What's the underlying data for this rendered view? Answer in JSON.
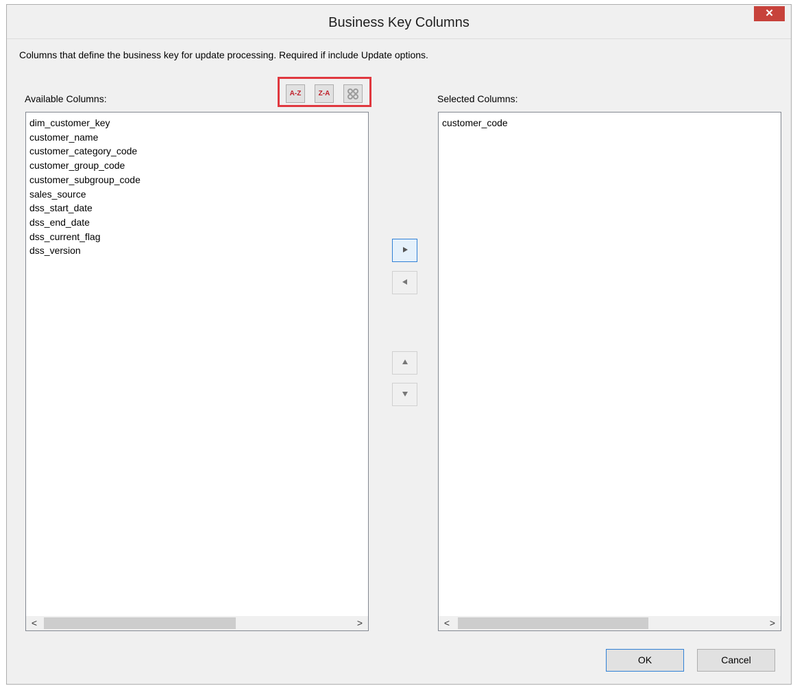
{
  "window": {
    "title": "Business Key Columns",
    "close_symbol": "✕"
  },
  "description": "Columns that define the business key for update processing. Required if include Update options.",
  "available": {
    "label": "Available Columns:",
    "items": [
      "dim_customer_key",
      "customer_name",
      "customer_category_code",
      "customer_group_code",
      "customer_subgroup_code",
      "sales_source",
      "dss_start_date",
      "dss_end_date",
      "dss_current_flag",
      "dss_version"
    ]
  },
  "selected": {
    "label": "Selected Columns:",
    "items": [
      "customer_code"
    ]
  },
  "sort_buttons": {
    "az": "A-Z",
    "za": "Z-A",
    "custom_icon": "shuffle-icon"
  },
  "move_buttons": {
    "add_icon": "triangle-right-icon",
    "remove_icon": "triangle-left-icon",
    "up_icon": "triangle-up-icon",
    "down_icon": "triangle-down-icon"
  },
  "scroll": {
    "left": "<",
    "right": ">"
  },
  "buttons": {
    "ok": "OK",
    "cancel": "Cancel"
  },
  "colors": {
    "highlight_box": "#e0383f",
    "close_button": "#c7423b",
    "focus_border": "#2f80d6"
  }
}
